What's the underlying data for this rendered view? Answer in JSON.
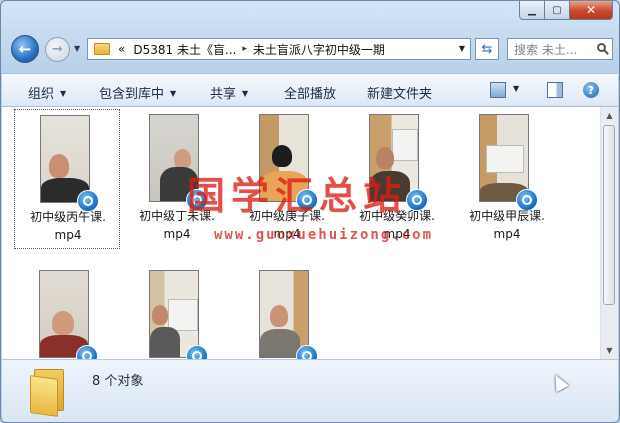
{
  "address": {
    "overflow_glyph": "«",
    "segments": [
      "D5381 未土《盲...",
      "未土盲派八字初中级一期"
    ],
    "separator": "▸"
  },
  "search": {
    "placeholder": "搜索 未土..."
  },
  "toolbar": {
    "organize": "组织",
    "include_in_library": "包含到库中",
    "share": "共享",
    "play_all": "全部播放",
    "new_folder": "新建文件夹"
  },
  "files": [
    {
      "line1": "初中级丙午课.",
      "line2": "mp4"
    },
    {
      "line1": "初中级丁未课.",
      "line2": "mp4"
    },
    {
      "line1": "初中级庚子课.",
      "line2": "mp4"
    },
    {
      "line1": "初中级癸卯课.",
      "line2": "mp4"
    },
    {
      "line1": "初中级甲辰课.",
      "line2": "mp4"
    },
    {
      "line1": "",
      "line2": ""
    },
    {
      "line1": "",
      "line2": ""
    },
    {
      "line1": "",
      "line2": ""
    }
  ],
  "watermark": {
    "cn": "国学汇总站",
    "url": "www.guoxuehuizong.com"
  },
  "status": {
    "count": "8 个对象"
  },
  "icons": {
    "back": "arrow-left-icon",
    "forward": "arrow-right-icon",
    "refresh": "refresh-icon",
    "search": "search-icon",
    "media": "media-player-badge-icon"
  },
  "colors": {
    "accent": "#2b6fc0",
    "watermark": "#dc1e14",
    "close": "#c84a2b"
  }
}
